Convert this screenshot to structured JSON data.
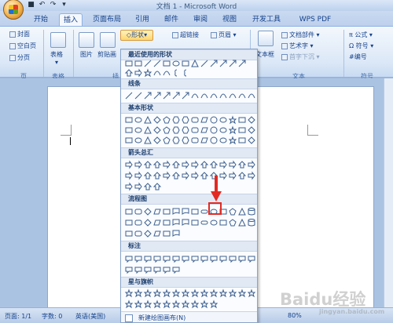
{
  "window": {
    "title": "文档 1 - Microsoft Word"
  },
  "tabs": [
    "开始",
    "插入",
    "页面布局",
    "引用",
    "邮件",
    "审阅",
    "视图",
    "开发工具",
    "WPS PDF"
  ],
  "active_tab": "插入",
  "ribbon": {
    "page_group": {
      "cover": "封面",
      "blank": "空白页",
      "break": "分页",
      "label": "页"
    },
    "table_group": {
      "table": "表格",
      "label": "表格"
    },
    "illus_group": {
      "picture": "图片",
      "clipart": "剪贴画",
      "shapes": "形状",
      "label": "插"
    },
    "links_group": {
      "hyperlink": "超链接"
    },
    "header_group": {
      "header": "页眉"
    },
    "text_group": {
      "textbox": "文本框",
      "quickparts": "文档部件",
      "wordart": "艺术字",
      "dropcap": "首字下沉",
      "label": "文本"
    },
    "symbols_group": {
      "equation": "公式",
      "symbol": "符号",
      "numbering": "编号",
      "label": "符号"
    }
  },
  "shapes_menu": {
    "sections": [
      "最近使用的形状",
      "线条",
      "基本形状",
      "箭头总汇",
      "流程图",
      "标注",
      "星与旗帜"
    ],
    "new_canvas": "新建绘图画布(N)"
  },
  "statusbar": {
    "page": "页面: 1/1",
    "words": "字数: 0",
    "lang": "英语(美国)",
    "zoom": "80%"
  },
  "watermark": {
    "text": "Baidu经验",
    "sub": "jingyan.baidu.com"
  },
  "colors": {
    "highlight": "#e32a22",
    "ribbon_accent": "#15428b"
  }
}
